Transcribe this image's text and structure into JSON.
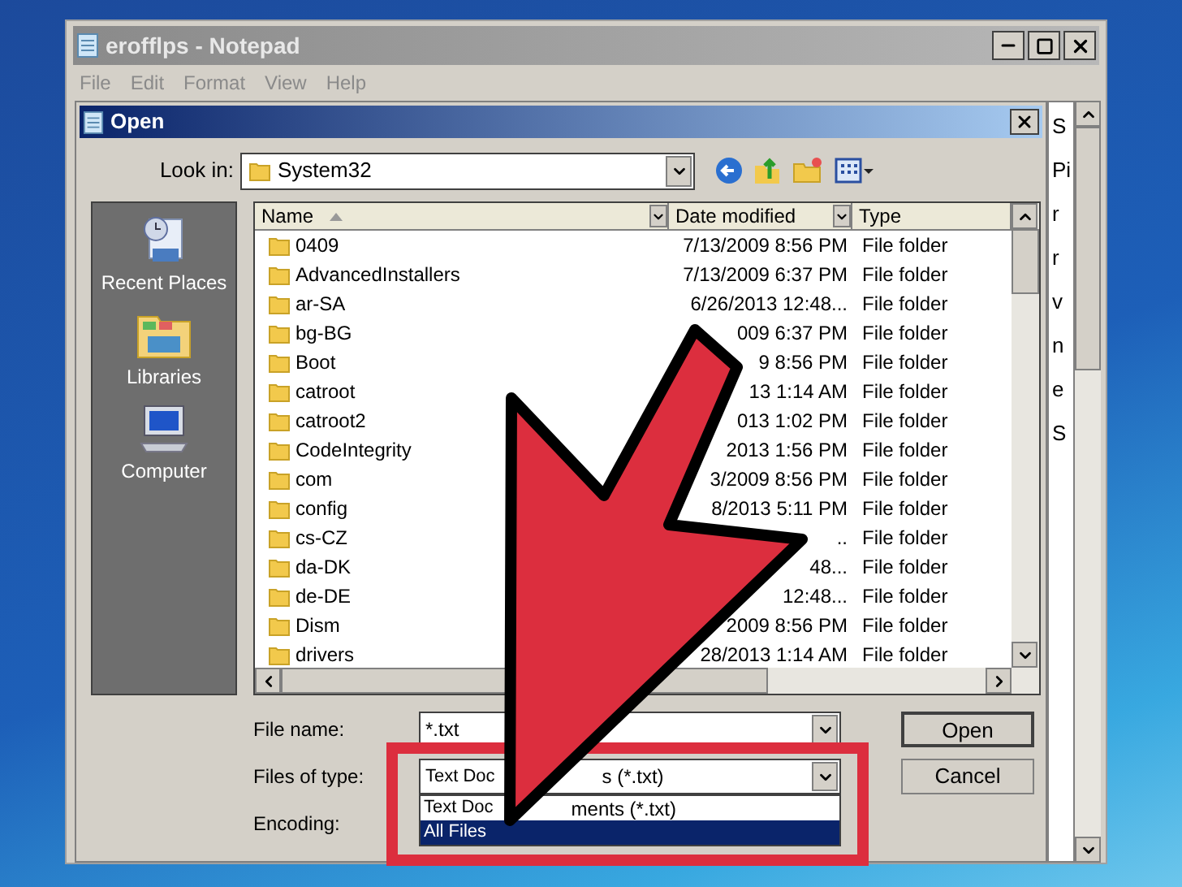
{
  "notepad": {
    "title": "erofflps - Notepad",
    "menu": [
      "File",
      "Edit",
      "Format",
      "View",
      "Help"
    ],
    "text_fragments": [
      "S",
      "Pi",
      "r",
      "r",
      "v",
      "n",
      "e",
      "S"
    ]
  },
  "dialog": {
    "title": "Open",
    "look_in_label": "Look in:",
    "look_in_value": "System32",
    "places": [
      "Recent Places",
      "Libraries",
      "Computer"
    ],
    "columns": [
      "Name",
      "Date modified",
      "Type"
    ],
    "rows": [
      {
        "name": "0409",
        "date": "7/13/2009 8:56 PM",
        "type": "File folder"
      },
      {
        "name": "AdvancedInstallers",
        "date": "7/13/2009 6:37 PM",
        "type": "File folder"
      },
      {
        "name": "ar-SA",
        "date": "6/26/2013 12:48...",
        "type": "File folder"
      },
      {
        "name": "bg-BG",
        "date": "009 6:37 PM",
        "type": "File folder"
      },
      {
        "name": "Boot",
        "date": "9 8:56 PM",
        "type": "File folder"
      },
      {
        "name": "catroot",
        "date": "13 1:14 AM",
        "type": "File folder"
      },
      {
        "name": "catroot2",
        "date": "013 1:02 PM",
        "type": "File folder"
      },
      {
        "name": "CodeIntegrity",
        "date": "2013 1:56 PM",
        "type": "File folder"
      },
      {
        "name": "com",
        "date": "3/2009 8:56 PM",
        "type": "File folder"
      },
      {
        "name": "config",
        "date": "8/2013 5:11 PM",
        "type": "File folder"
      },
      {
        "name": "cs-CZ",
        "date": "..",
        "type": "File folder"
      },
      {
        "name": "da-DK",
        "date": "48...",
        "type": "File folder"
      },
      {
        "name": "de-DE",
        "date": "12:48...",
        "type": "File folder"
      },
      {
        "name": "Dism",
        "date": "2009 8:56 PM",
        "type": "File folder"
      },
      {
        "name": "drivers",
        "date": "28/2013 1:14 AM",
        "type": "File folder"
      }
    ],
    "file_name_label": "File name:",
    "file_name_value": "*.txt",
    "file_type_label": "Files of type:",
    "file_type_value": [
      "Text Doc",
      "s (*.txt)"
    ],
    "file_type_options": [
      {
        "parts": [
          "Text Doc",
          "ments (*.txt)"
        ],
        "selected": false
      },
      {
        "parts": [
          "All Files"
        ],
        "selected": true
      }
    ],
    "encoding_label": "Encoding:",
    "buttons": [
      "Open",
      "Cancel"
    ]
  }
}
